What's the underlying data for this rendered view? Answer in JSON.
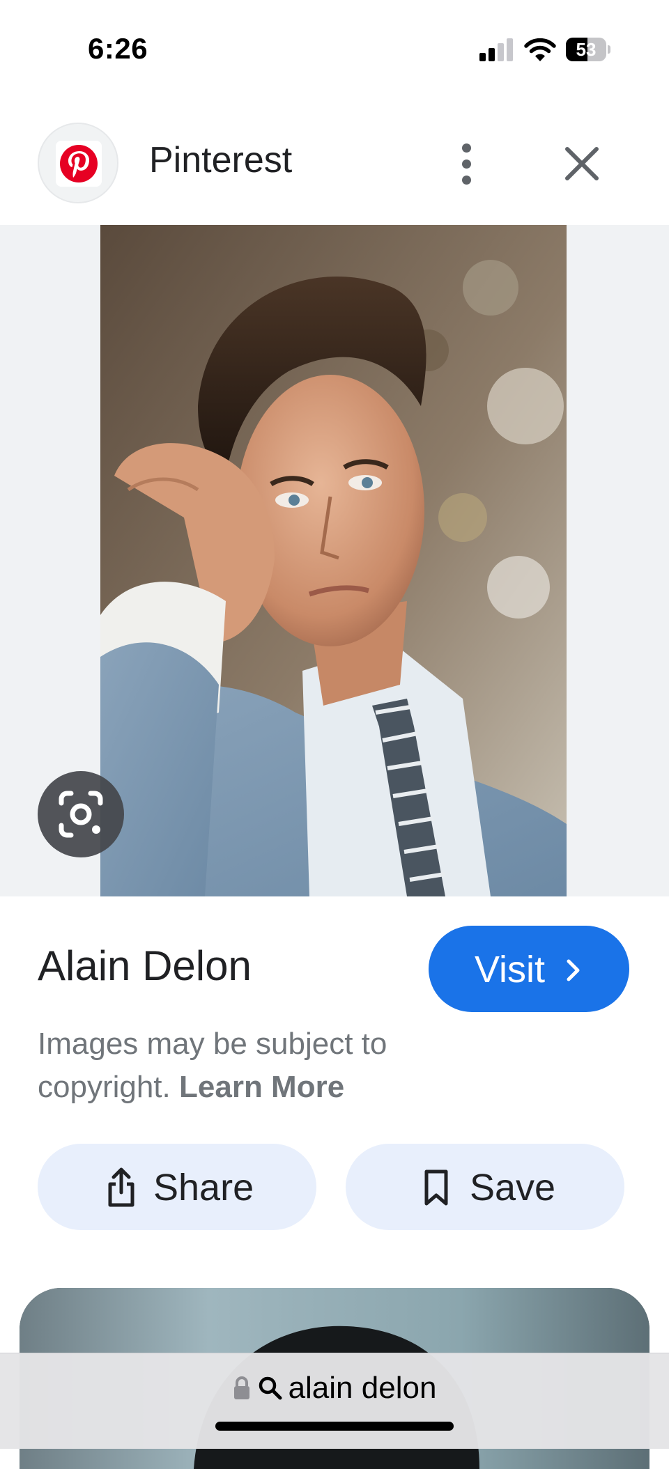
{
  "status_bar": {
    "time": "6:26",
    "battery_level": "53"
  },
  "header": {
    "site_name": "Pinterest",
    "logo_icon": "pinterest-logo-icon",
    "more_icon": "more-vertical-icon",
    "close_icon": "close-icon"
  },
  "image": {
    "lens_icon": "google-lens-icon"
  },
  "result": {
    "title": "Alain Delon",
    "visit_label": "Visit",
    "copyright_text": "Images may be subject to copyright.",
    "learn_more_label": "Learn More"
  },
  "actions": {
    "share_label": "Share",
    "save_label": "Save"
  },
  "address_bar": {
    "query": "alain delon"
  },
  "colors": {
    "accent": "#1a73e8",
    "pinterest_red": "#e60023",
    "action_button_bg": "#e8effc"
  }
}
